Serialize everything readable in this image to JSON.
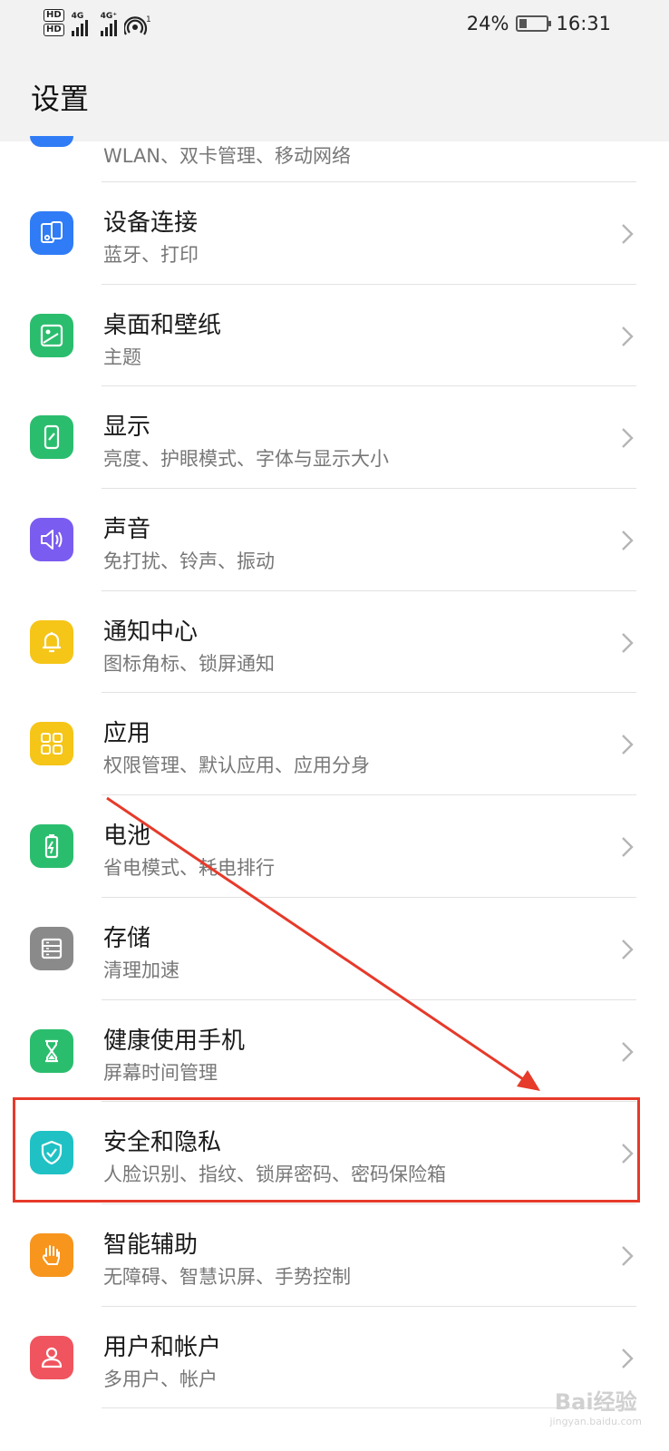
{
  "status_bar": {
    "hd1": "HD",
    "hd2": "HD",
    "net1": "4G",
    "net2": "4G⁺",
    "hotspot_count": "1",
    "battery": "24%",
    "time": "16:31"
  },
  "header": {
    "title": "设置"
  },
  "list": {
    "partial_subtitle": "WLAN、双卡管理、移动网络",
    "items": [
      {
        "title": "设备连接",
        "subtitle": "蓝牙、打印",
        "icon": "device-connect-icon",
        "color": "#2f7cf6"
      },
      {
        "title": "桌面和壁纸",
        "subtitle": "主题",
        "icon": "wallpaper-icon",
        "color": "#2bbd6e"
      },
      {
        "title": "显示",
        "subtitle": "亮度、护眼模式、字体与显示大小",
        "icon": "display-icon",
        "color": "#2bbd6e"
      },
      {
        "title": "声音",
        "subtitle": "免打扰、铃声、振动",
        "icon": "sound-icon",
        "color": "#7b5cf0"
      },
      {
        "title": "通知中心",
        "subtitle": "图标角标、锁屏通知",
        "icon": "bell-icon",
        "color": "#f5c518"
      },
      {
        "title": "应用",
        "subtitle": "权限管理、默认应用、应用分身",
        "icon": "apps-grid-icon",
        "color": "#f5c518"
      },
      {
        "title": "电池",
        "subtitle": "省电模式、耗电排行",
        "icon": "battery-icon",
        "color": "#2bbd6e"
      },
      {
        "title": "存储",
        "subtitle": "清理加速",
        "icon": "storage-icon",
        "color": "#8a8a8a"
      },
      {
        "title": "健康使用手机",
        "subtitle": "屏幕时间管理",
        "icon": "hourglass-icon",
        "color": "#2bbd6e"
      },
      {
        "title": "安全和隐私",
        "subtitle": "人脸识别、指纹、锁屏密码、密码保险箱",
        "icon": "shield-check-icon",
        "color": "#1fc1c4"
      },
      {
        "title": "智能辅助",
        "subtitle": "无障碍、智慧识屏、手势控制",
        "icon": "hand-icon",
        "color": "#f7951d"
      },
      {
        "title": "用户和帐户",
        "subtitle": "多用户、帐户",
        "icon": "user-icon",
        "color": "#f0545e"
      }
    ]
  },
  "annotation": {
    "color": "#e63a2a",
    "highlighted_item": "安全和隐私"
  },
  "watermark": {
    "brand": "Bai",
    "brand2": "经验",
    "url": "jingyan.baidu.com"
  }
}
